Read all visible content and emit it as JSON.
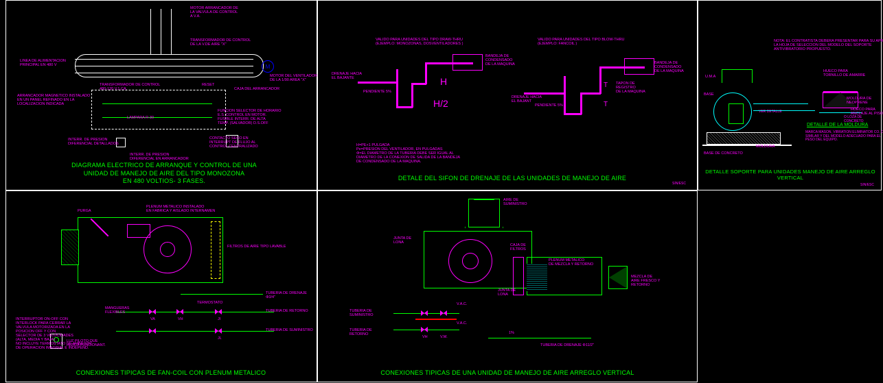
{
  "panels": {
    "p1": {
      "title_line1": "DIAGRAMA ELECTRICO DE ARRANQUE Y CONTROL DE UNA",
      "title_line2": "UNIDAD DE MANEJO DE AIRE DEL TIPO MONOZONA",
      "title_line3": "EN 480 VOLTIOS- 3 FASES.",
      "anno": {
        "a1": "MOTOR ARRANCADOR DE\nLA VALVULA DE CONTROL\nA V.A.",
        "a2": "TRANSFORMADOR DE CONTROL\nDE LA V.DE AIRE \"X\"",
        "a3": "LINEA DE ALIMENTACION\nPRINCIPAL EN 480 V",
        "a4": "MOTOR DEL VENTILADOR\nDE LA 1/90 AREA \"X\"",
        "a5": "TRANSFORMADOR DE CONTROL\n480-120 V.1.CA.",
        "a6": "RESET",
        "a7": "CAJA DEL ARRANCADOR",
        "a8": "ARRANCADOR MAGNETICO INSTALADO\nEN UN PANEL REFINADO EN LA\nLOCALIZACION INDICADA",
        "a9": "LAMPARA R-30",
        "a10": "FUNCION SELECTOR DE HORARIO\nE.S. CONTROL EN MOTOR.\nFUSIBLE INTERR. DE ALTA\nTEMP. (SALVADOR) D.S.OFF",
        "a11": "INTERR. DE PRESION\nDIFERENCIAL DETALLADOS",
        "a12": "CONTACTO SECO EN\nINTERRUPT DE FLUJO AL\nCONTROL CENTRALIZADO",
        "a13": "INTERR. DE PRESION\nDIFERENCIAL EN ARRANCADOR"
      },
      "sym": {
        "m": "M"
      }
    },
    "p2": {
      "title": "DETALE DEL SIFON DE DRENAJE DE LAS UNIDADES DE MANEJO DE AIRE",
      "scale": "SIN/ESC",
      "anno": {
        "a1": "VALIDO PARA UNIDADES DEL TIPO DRAW-THRU\n(EJEMPLO: MONOZONAS, DOSVENTILADORES )",
        "a2": "VALIDO PARA UNIDADES DEL TIPO BLOW-THRU\n(EJEMPLO: FANCOIL )",
        "a3": "DRENAJE HACIA\nEL BAJANTE",
        "a4": "PENDIENTE 5%",
        "a5": "BANDEJA DE\nCONDENSADO\nDE LA MAQUINA",
        "a6": "TAPON DE\nREGISTRO\nDE LA MAQUINA",
        "a7": "DRENAJE HACIA\nEL BAJANT",
        "a8": "PENDIENTE 5%",
        "a9": "BANDEJA DE\nCONDENSADO\nDE LA MAQUINA",
        "h": "H",
        "h2": "H/2",
        "t": "T",
        "tt": "T",
        "note": "H=PE+1 PULGADA\nPe=PRESION DEL VENTILADOR, EN PULGADAS\nΦ=EL DIAMETRO DE LA TUBERIA DEBE SER IGUAL AL\nDIAMETRO DE LA CONEXION DE SALIDA DE LA BANDEJA\nDE CONDENSADO DE LA MAQUINA."
      }
    },
    "p3": {
      "title": "DETALLE SOPORTE PARA UNIDADES MANEJO DE AIRE ARREGLO VERTICAL",
      "scale": "SIN/ESC",
      "sub_title": "DETALLE DE LA MOLDURA",
      "anno": {
        "a1": "NOTA: EL CONTRATISTA DEBERA PRESENTAR PARA SU APROBACION\nLA HOJA DE SELECCION DEL MODELO DEL SOPORTE\nANTIVIBRATORIO PROPUESTO.",
        "a2": "U.M.A",
        "a3": "BASE",
        "a4": "HUECO PARA\nTORNILLO DE AMARRE",
        "a5": "MOLDURA DE NEOPRENE",
        "a6": "HUECO PARA\nANCLAJE AL PISO",
        "a7": "MOLDURA",
        "a8": "BASE DE CONCRETO",
        "a9": "VER DETALLE",
        "a10": "MARCA MASON, VIBRATION ELIMINATOR CO. O\nSIMILAR Y DEL MODELO ADECUADO PARA EL\nPESO DEL EQUIPO.",
        "a11": "O LOZA DE CONCRETO"
      }
    },
    "p4": {
      "title": "CONEXIONES TIPICAS DE FAN-COIL CON PLENUM METALICO",
      "anno": {
        "a1": "PURGA",
        "a2": "PLENUM METALICO INSTALADO\nEN FABRICA Y AISLADO INTERNAMEN",
        "a3": "FILTROS DE AIRE TIPO LAVABLE",
        "a4": "TUBERIA DE DRENAJE Φ3/4\"",
        "a5": "MANGUERAS\nFLEXIBLES",
        "a6": "TERMOSTATO",
        "a7": "VA",
        "a8": "VH",
        "a9": "JI",
        "a10": "JL",
        "a11": "TUBERIA DE RETORNO",
        "a12": "TUBERIA DE SUMINISTRO",
        "a13": "INTERRUPTOR ON-OFF CON\nINTERLOCK PARA CERRAR LA\nVALVULA MOTORIZADA EN LA\nPOSICION OFF Y CON\nSELECTOR DE 3 VELOCIDADES\n(ALTA, MEDIA Y BAJA)\nNO INCLUYE TERMOSTATO DE AMBIENTE\nDE OPERACION IMAGINAL E INDEPEND.",
        "a14": "LUZ PILOTO QUE\nINDICA FUNCIONANT."
      }
    },
    "p5": {
      "title": "CONEXIONES TIPICAS DE UNA UNIDAD DE MANEJO DE AIRE ARREGLO VERTICAL",
      "anno": {
        "a1": "AIRE DE\nSUMINISTRO",
        "a2": "JUNTA DE\nLONA",
        "a3": "CAJA DE\nFILTROS",
        "a4": "JUNTA DE\nLONA",
        "a5": "PLENUM METALICO\nDE MEZCLA Y RETORNO",
        "a6": "MEZCLA DE\nAIRE FRESCO Y\nRETORNO",
        "a7": "V.A.C.",
        "a8": "V.A.C.",
        "a9": "VH",
        "a10": "V.M.",
        "a11": "TUBERIA DE\nSUMINISTRO",
        "a12": "TUBERIA DE\nRETORNO",
        "a13": "1%",
        "a14": "TUBERIA DE DRENAJE Φ11/2\""
      }
    }
  }
}
